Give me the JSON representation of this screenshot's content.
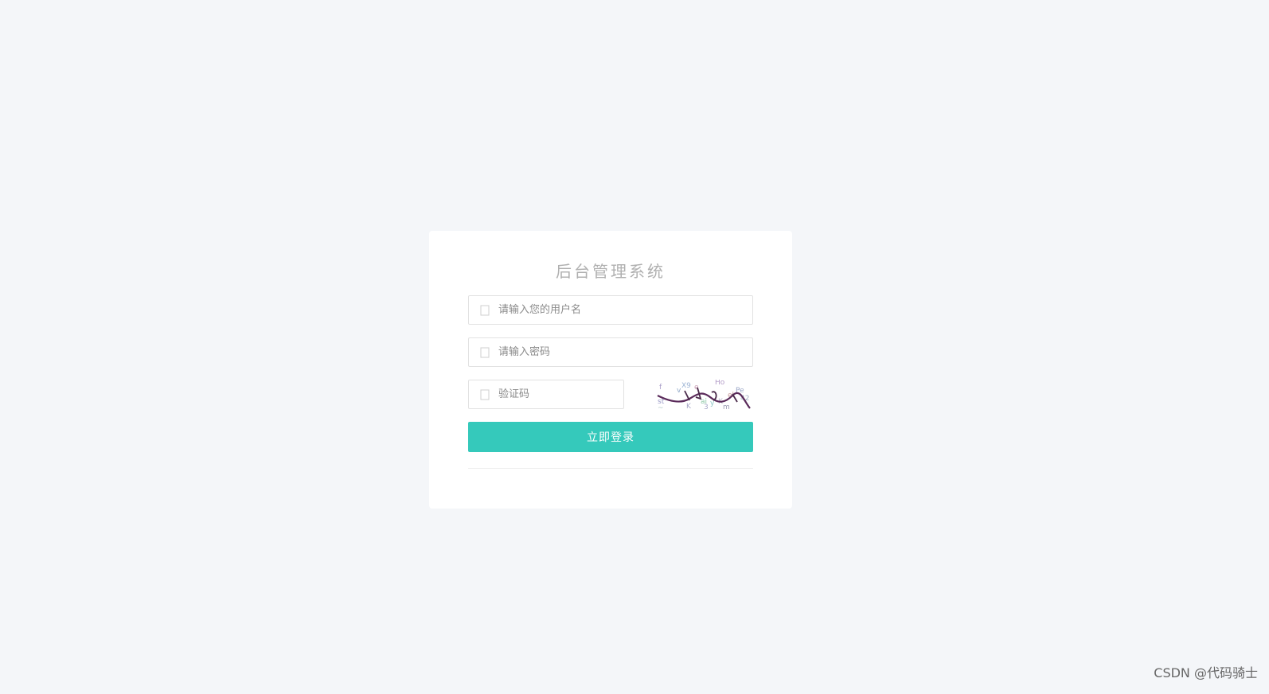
{
  "login": {
    "title": "后台管理系统",
    "username": {
      "placeholder": "请输入您的用户名",
      "value": "",
      "icon": "user-icon"
    },
    "password": {
      "placeholder": "请输入密码",
      "value": "",
      "icon": "lock-icon"
    },
    "captcha": {
      "placeholder": "验证码",
      "value": "",
      "icon": "shield-icon"
    },
    "submit_label": "立即登录"
  },
  "watermark": "CSDN @代码骑士",
  "colors": {
    "background": "#f4f6f9",
    "card": "#ffffff",
    "accent": "#35c9bb",
    "title": "#b0b0b0"
  }
}
